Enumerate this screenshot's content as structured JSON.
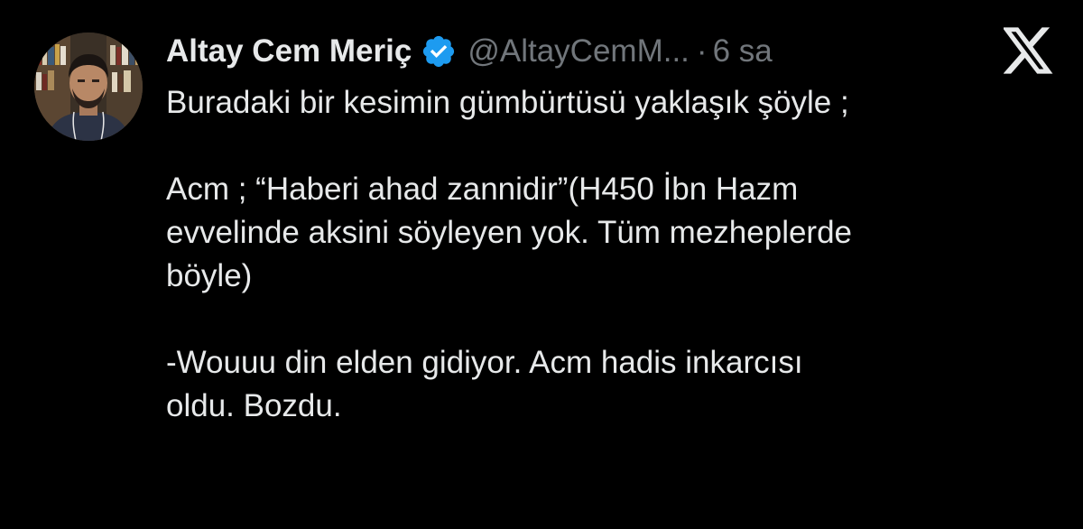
{
  "tweet": {
    "author": {
      "display_name": "Altay Cem Meriç",
      "handle": "@AltayCemM...",
      "verified": true,
      "avatar_icon": "profile-photo"
    },
    "separator": "·",
    "timestamp": "6 sa",
    "platform_icon": "x-logo-icon",
    "lines": [
      "Buradaki bir kesimin gümbürtüsü yaklaşık şöyle ;",
      "",
      "Acm ; “Haberi ahad zannidir”(H450 İbn Hazm",
      "evvelinde aksini söyleyen yok. Tüm mezheplerde",
      "böyle)",
      "",
      "-Wouuu din elden gidiyor. Acm hadis inkarcısı",
      "oldu. Bozdu."
    ]
  },
  "colors": {
    "background": "#000000",
    "text": "#e7e9ea",
    "secondary_text": "#71767b",
    "verified_badge": "#1d9bf0"
  }
}
